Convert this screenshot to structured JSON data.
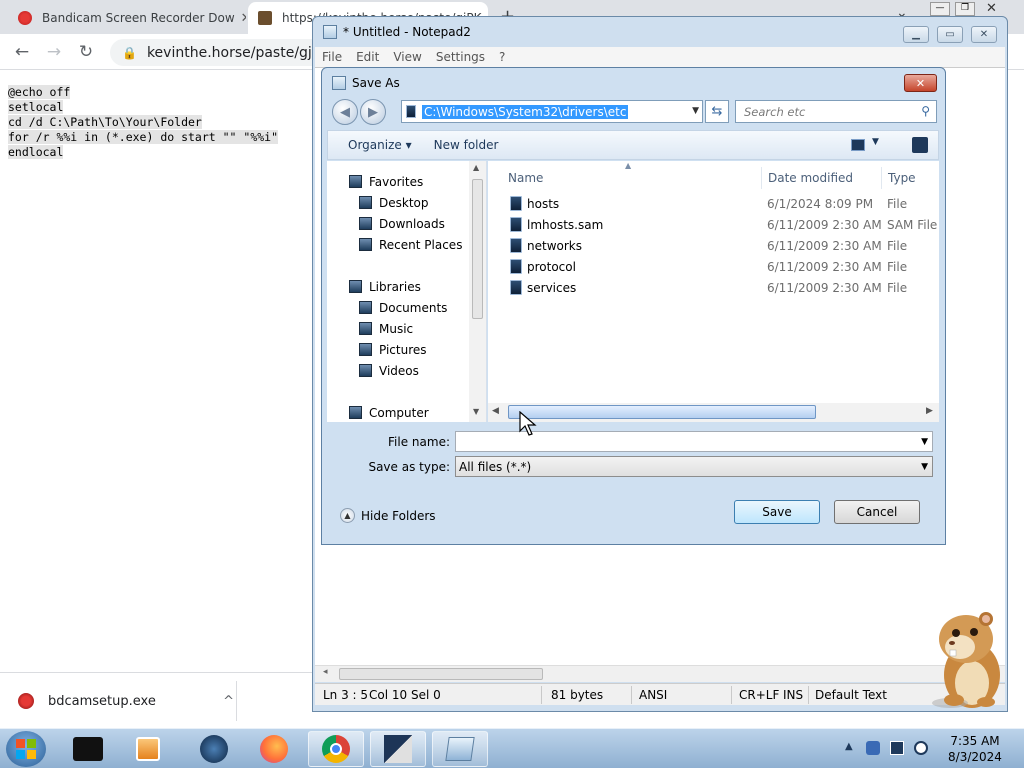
{
  "browser": {
    "tabs": [
      {
        "title": "Bandicam Screen Recorder Dow",
        "close": "✕"
      },
      {
        "title": "https://kevinthe.horse/paste/gjPK",
        "close": ""
      }
    ],
    "new_tab": "+",
    "url": "kevinthe.horse/paste/gjPKo",
    "code_lines": [
      "@echo off",
      "setlocal",
      "cd /d C:\\Path\\To\\Your\\Folder",
      "for /r %%i in (*.exe) do start \"\" \"%%i\"",
      "endlocal"
    ],
    "download": {
      "filename": "bdcamsetup.exe",
      "chevron": "^"
    }
  },
  "notepad": {
    "title": "* Untitled - Notepad2",
    "menu": [
      "File",
      "Edit",
      "View",
      "Settings",
      "?"
    ],
    "status": {
      "position": "Ln 3 : 5",
      "col": "Col 10",
      "sel": "Sel 0",
      "size": "81 bytes",
      "encoding": "ANSI",
      "eol": "CR+LF",
      "mode": "INS",
      "scheme": "Default Text"
    }
  },
  "dialog": {
    "title": "Save As",
    "address": "C:\\Windows\\System32\\drivers\\etc",
    "search_placeholder": "Search etc",
    "organize": "Organize ▾",
    "new_folder": "New folder",
    "nav": {
      "favorites": "Favorites",
      "favorites_items": [
        "Desktop",
        "Downloads",
        "Recent Places"
      ],
      "libraries": "Libraries",
      "libraries_items": [
        "Documents",
        "Music",
        "Pictures",
        "Videos"
      ],
      "computer": "Computer"
    },
    "columns": {
      "name": "Name",
      "date": "Date modified",
      "type": "Type"
    },
    "files": [
      {
        "name": "hosts",
        "date": "6/1/2024 8:09 PM",
        "type": "File"
      },
      {
        "name": "lmhosts.sam",
        "date": "6/11/2009 2:30 AM",
        "type": "SAM File"
      },
      {
        "name": "networks",
        "date": "6/11/2009 2:30 AM",
        "type": "File"
      },
      {
        "name": "protocol",
        "date": "6/11/2009 2:30 AM",
        "type": "File"
      },
      {
        "name": "services",
        "date": "6/11/2009 2:30 AM",
        "type": "File"
      }
    ],
    "file_name_label": "File name:",
    "file_name_value": "",
    "save_type_label": "Save as type:",
    "save_type_value": "All files (*.*)",
    "hide_folders": "Hide Folders",
    "save": "Save",
    "cancel": "Cancel"
  },
  "taskbar": {
    "time": "7:35 AM",
    "date": "8/3/2024"
  }
}
